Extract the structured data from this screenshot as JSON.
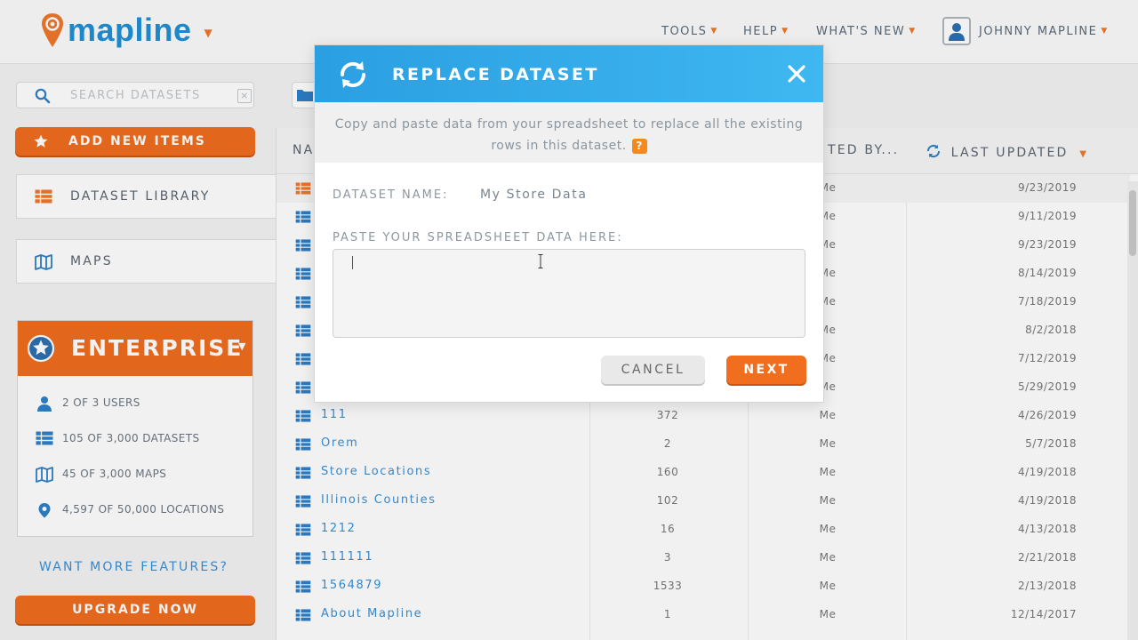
{
  "header": {
    "logo_text": "mapline",
    "nav": [
      {
        "label": "TOOLS"
      },
      {
        "label": "HELP"
      },
      {
        "label": "WHAT'S NEW"
      }
    ],
    "user_name": "JOHNNY MAPLINE"
  },
  "sidebar": {
    "search_placeholder": "SEARCH DATASETS",
    "add_new_label": "ADD NEW ITEMS",
    "items": [
      {
        "label": "DATASET LIBRARY"
      },
      {
        "label": "MAPS"
      }
    ],
    "plan": {
      "name": "ENTERPRISE",
      "stats": [
        {
          "label": "2 OF 3 USERS",
          "icon": "user-icon"
        },
        {
          "label": "105 OF 3,000 DATASETS",
          "icon": "table-icon"
        },
        {
          "label": "45 OF 3,000 MAPS",
          "icon": "map-icon"
        },
        {
          "label": "4,597 OF 50,000 LOCATIONS",
          "icon": "pin-icon"
        }
      ]
    },
    "want_more_label": "WANT MORE FEATURES?",
    "upgrade_label": "UPGRADE NOW"
  },
  "table": {
    "columns": {
      "name": "NA",
      "created_by": "TED BY...",
      "last_updated": "LAST UPDATED"
    },
    "rows": [
      {
        "name": "",
        "count": "",
        "by": "Me",
        "date": "9/23/2019"
      },
      {
        "name": "",
        "count": "",
        "by": "Me",
        "date": "9/11/2019"
      },
      {
        "name": "",
        "count": "",
        "by": "Me",
        "date": "9/23/2019"
      },
      {
        "name": "",
        "count": "",
        "by": "Me",
        "date": "8/14/2019"
      },
      {
        "name": "",
        "count": "",
        "by": "Me",
        "date": "7/18/2019"
      },
      {
        "name": "",
        "count": "",
        "by": "Me",
        "date": "8/2/2018"
      },
      {
        "name": "",
        "count": "",
        "by": "Me",
        "date": "7/12/2019"
      },
      {
        "name": "",
        "count": "",
        "by": "Me",
        "date": "5/29/2019"
      },
      {
        "name": "111",
        "count": "372",
        "by": "Me",
        "date": "4/26/2019"
      },
      {
        "name": "Orem",
        "count": "2",
        "by": "Me",
        "date": "5/7/2018"
      },
      {
        "name": "Store Locations",
        "count": "160",
        "by": "Me",
        "date": "4/19/2018"
      },
      {
        "name": "Illinois Counties",
        "count": "102",
        "by": "Me",
        "date": "4/19/2018"
      },
      {
        "name": "1212",
        "count": "16",
        "by": "Me",
        "date": "4/13/2018"
      },
      {
        "name": "111111",
        "count": "3",
        "by": "Me",
        "date": "2/21/2018"
      },
      {
        "name": "1564879",
        "count": "1533",
        "by": "Me",
        "date": "2/13/2018"
      },
      {
        "name": "About Mapline",
        "count": "1",
        "by": "Me",
        "date": "12/14/2017"
      }
    ]
  },
  "modal": {
    "title": "REPLACE DATASET",
    "intro": "Copy and paste data from your spreadsheet to replace all the existing rows in this dataset.",
    "help_mark": "?",
    "dataset_name_label": "DATASET NAME:",
    "dataset_name_value": "My Store Data",
    "paste_label": "PASTE YOUR SPREADSHEET DATA HERE:",
    "paste_value": "",
    "cancel_label": "CANCEL",
    "next_label": "NEXT"
  },
  "colors": {
    "brand_blue": "#1f8fd6",
    "brand_orange": "#f06e1e",
    "modal_header": "#2a9fe2"
  }
}
